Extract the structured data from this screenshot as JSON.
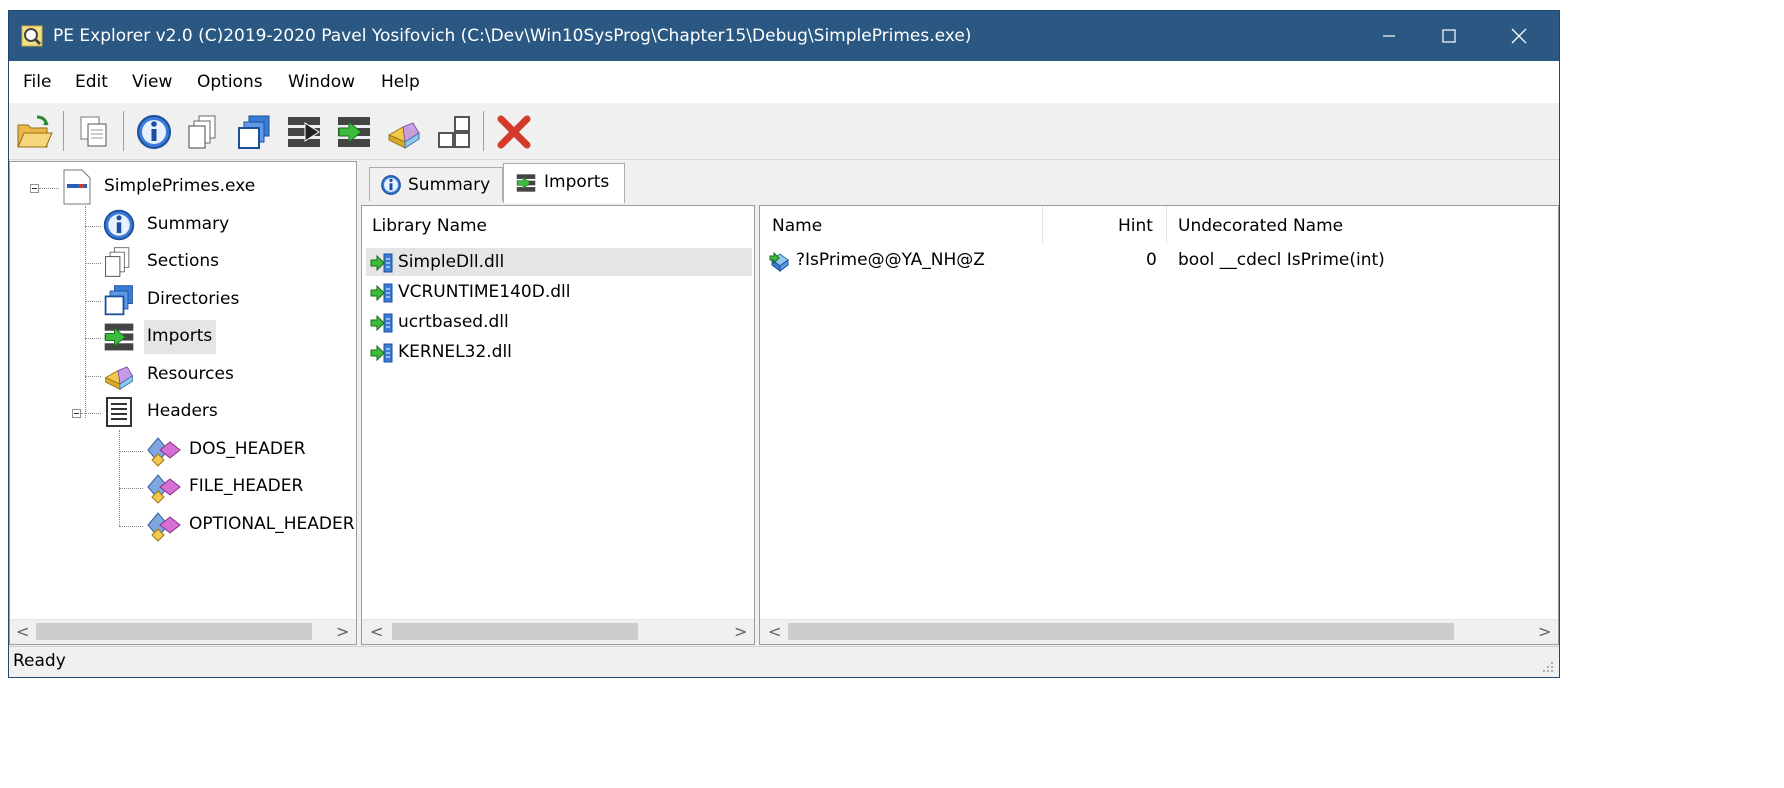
{
  "window": {
    "title": "PE Explorer v2.0 (C)2019-2020 Pavel Yosifovich (C:\\Dev\\Win10SysProg\\Chapter15\\Debug\\SimplePrimes.exe)"
  },
  "menu": [
    "File",
    "Edit",
    "View",
    "Options",
    "Window",
    "Help"
  ],
  "toolbar": [
    "open-icon",
    "copy-icon",
    "summary-icon",
    "sections-icon",
    "directories-icon",
    "exports-icon",
    "imports-icon",
    "resources-icon",
    "headers-icon",
    "close-file-icon"
  ],
  "tree": {
    "root": "SimplePrimes.exe",
    "items": [
      "Summary",
      "Sections",
      "Directories",
      "Imports",
      "Resources",
      "Headers"
    ],
    "header_children": [
      "DOS_HEADER",
      "FILE_HEADER",
      "OPTIONAL_HEADER"
    ]
  },
  "tabs": [
    "Summary",
    "Imports"
  ],
  "libraries": {
    "header": "Library Name",
    "items": [
      "SimpleDll.dll",
      "VCRUNTIME140D.dll",
      "ucrtbased.dll",
      "KERNEL32.dll"
    ]
  },
  "functions": {
    "headers": [
      "Name",
      "Hint",
      "Undecorated Name"
    ],
    "rows": [
      {
        "name": "?IsPrime@@YA_NH@Z",
        "hint": "0",
        "undecorated": "bool __cdecl IsPrime(int)"
      }
    ]
  },
  "status": "Ready",
  "colors": {
    "titlebar": "#2b5882",
    "selection": "#e5e5e5"
  }
}
